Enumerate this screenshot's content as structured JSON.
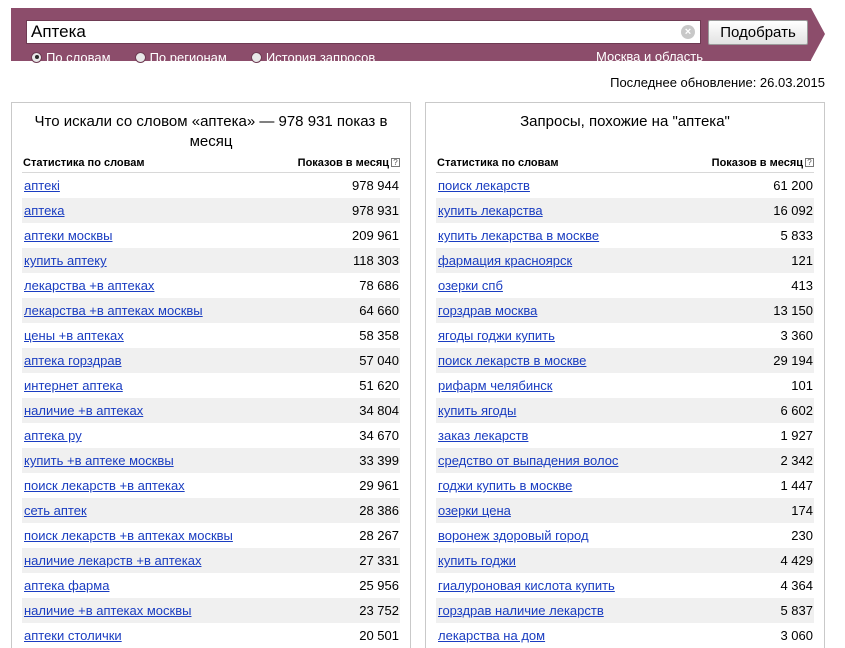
{
  "search": {
    "query": "Аптека",
    "submit_label": "Подобрать",
    "clear_icon": "×",
    "options": [
      {
        "label": "По словам",
        "checked": true
      },
      {
        "label": "По регионам",
        "checked": false
      },
      {
        "label": "История запросов",
        "checked": false
      }
    ],
    "region": "Москва и область"
  },
  "last_update": "Последнее обновление: 26.03.2015",
  "left_panel": {
    "title": "Что искали со словом «аптека» — 978 931 показ в месяц",
    "col_phrase": "Статистика по словам",
    "col_count": "Показов в месяц",
    "help": "?",
    "rows": [
      {
        "phrase": "аптекі",
        "count": "978 944"
      },
      {
        "phrase": "аптека",
        "count": "978 931"
      },
      {
        "phrase": "аптеки москвы",
        "count": "209 961"
      },
      {
        "phrase": "купить аптеку",
        "count": "118 303"
      },
      {
        "phrase": "лекарства +в аптеках",
        "count": "78 686"
      },
      {
        "phrase": "лекарства +в аптеках москвы",
        "count": "64 660"
      },
      {
        "phrase": "цены +в аптеках",
        "count": "58 358"
      },
      {
        "phrase": "аптека горздрав",
        "count": "57 040"
      },
      {
        "phrase": "интернет аптека",
        "count": "51 620"
      },
      {
        "phrase": "наличие +в аптеках",
        "count": "34 804"
      },
      {
        "phrase": "аптека ру",
        "count": "34 670"
      },
      {
        "phrase": "купить +в аптеке москвы",
        "count": "33 399"
      },
      {
        "phrase": "поиск лекарств +в аптеках",
        "count": "29 961"
      },
      {
        "phrase": "сеть аптек",
        "count": "28 386"
      },
      {
        "phrase": "поиск лекарств +в аптеках москвы",
        "count": "28 267"
      },
      {
        "phrase": "наличие лекарств +в аптеках",
        "count": "27 331"
      },
      {
        "phrase": "аптека фарма",
        "count": "25 956"
      },
      {
        "phrase": "наличие +в аптеках москвы",
        "count": "23 752"
      },
      {
        "phrase": "аптеки столички",
        "count": "20 501"
      }
    ]
  },
  "right_panel": {
    "title": "Запросы, похожие на \"аптека\"",
    "col_phrase": "Статистика по словам",
    "col_count": "Показов в месяц",
    "help": "?",
    "rows": [
      {
        "phrase": "поиск лекарств",
        "count": "61 200"
      },
      {
        "phrase": "купить лекарства",
        "count": "16 092"
      },
      {
        "phrase": "купить лекарства в москве",
        "count": "5 833"
      },
      {
        "phrase": "фармация красноярск",
        "count": "121"
      },
      {
        "phrase": "озерки спб",
        "count": "413"
      },
      {
        "phrase": "горздрав москва",
        "count": "13 150"
      },
      {
        "phrase": "ягоды годжи купить",
        "count": "3 360"
      },
      {
        "phrase": "поиск лекарств в москве",
        "count": "29 194"
      },
      {
        "phrase": "рифарм челябинск",
        "count": "101"
      },
      {
        "phrase": "купить ягоды",
        "count": "6 602"
      },
      {
        "phrase": "заказ лекарств",
        "count": "1 927"
      },
      {
        "phrase": "средство от выпадения волос",
        "count": "2 342"
      },
      {
        "phrase": "годжи купить в москве",
        "count": "1 447"
      },
      {
        "phrase": "озерки цена",
        "count": "174"
      },
      {
        "phrase": "воронеж здоровый город",
        "count": "230"
      },
      {
        "phrase": "купить годжи",
        "count": "4 429"
      },
      {
        "phrase": "гиалуроновая кислота купить",
        "count": "4 364"
      },
      {
        "phrase": "горздрав наличие лекарств",
        "count": "5 837"
      },
      {
        "phrase": "лекарства на дом",
        "count": "3 060"
      }
    ]
  }
}
